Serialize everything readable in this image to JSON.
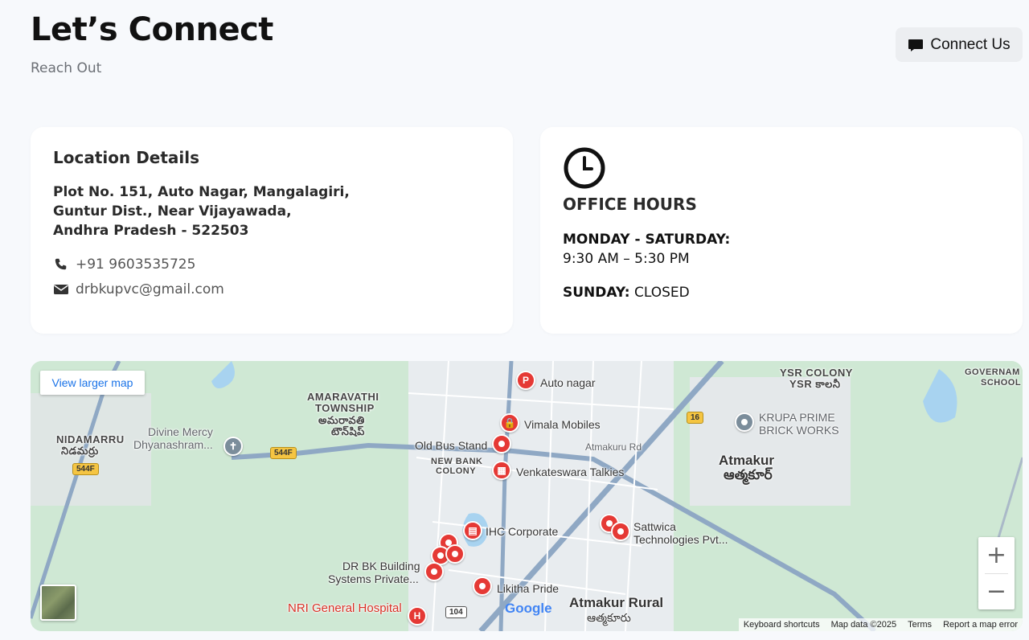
{
  "header": {
    "title": "Let’s Connect",
    "subtitle": "Reach Out",
    "connect_label": "Connect Us"
  },
  "location": {
    "title": "Location Details",
    "address_lines": [
      "Plot No. 151, Auto Nagar, Mangalagiri,",
      "Guntur Dist., Near Vijayawada,",
      "Andhra Pradesh - 522503"
    ],
    "phone": "+91 9603535725",
    "email": "drbkupvc@gmail.com"
  },
  "hours": {
    "title": "OFFICE HOURS",
    "weekday_label": "MONDAY - SATURDAY:",
    "weekday_time": "9:30 AM – 5:30 PM",
    "sunday_label": "SUNDAY:",
    "sunday_value": "CLOSED"
  },
  "map": {
    "view_larger": "View larger map",
    "labels": {
      "auto_nagar": "Auto nagar",
      "ysr_colony": "YSR COLONY",
      "ysr_colony_te": "YSR కాలనీ",
      "government_school_1": "GOVERNAM",
      "government_school_2": "SCHOOL",
      "amaravathi_1": "AMARAVATHI",
      "amaravathi_2": "TOWNSHIP",
      "amaravathi_te_1": "అమరావతి",
      "amaravathi_te_2": "టౌన్‌షిప్",
      "vimala": "Vimala Mobiles",
      "krupa_1": "KRUPA PRIME",
      "krupa_2": "BRICK WORKS",
      "nidamarru": "NIDAMARRU",
      "nidamarru_te": "నిడమర్రు",
      "divine_1": "Divine Mercy",
      "divine_2": "Dhyanashram...",
      "old_bus": "Old Bus Stand",
      "atmakuru_rd": "Atmakuru Rd",
      "new_bank_1": "NEW BANK",
      "new_bank_2": "COLONY",
      "venkateswara": "Venkateswara Talkies",
      "atmakur": "Atmakur",
      "atmakur_te": "ఆత్మకూర్",
      "ihc": "IHC Corporate",
      "sattwica_1": "Sattwica",
      "sattwica_2": "Technologies Pvt...",
      "drbk_1": "DR BK Building",
      "drbk_2": "Systems Private...",
      "likitha": "Likitha Pride",
      "nri": "NRI General Hospital",
      "atmakur_rural": "Atmakur Rural",
      "atmakur_rural_te": "ఆత్మకూరు"
    },
    "shields": {
      "r544f_a": "544F",
      "r544f_b": "544F",
      "r16": "16",
      "r104": "104"
    },
    "pins": {
      "parking": "P",
      "hospital": "H"
    },
    "google": "Google",
    "zoom_in": "+",
    "zoom_out": "−",
    "attribution": [
      "Keyboard shortcuts",
      "Map data ©2025",
      "Terms",
      "Report a map error"
    ]
  },
  "colors": {
    "accent_link": "#1a73e8",
    "pin_red": "#e53935",
    "page_bg": "#f7f9fc"
  }
}
